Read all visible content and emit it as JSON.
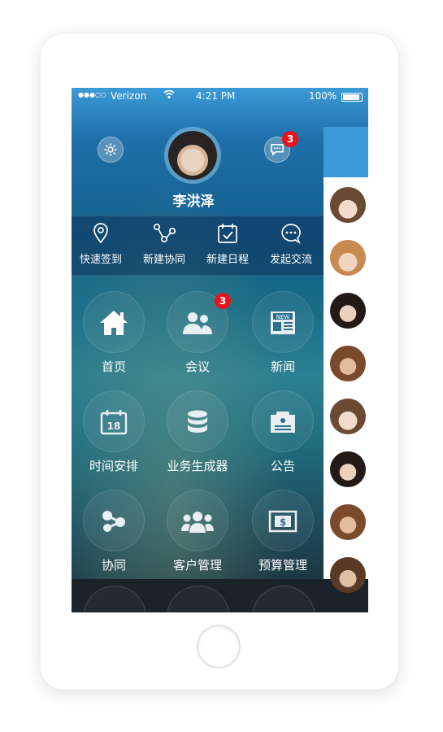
{
  "status_bar": {
    "signal": "●●●○○",
    "carrier": "Verizon",
    "time": "4:21 PM",
    "battery": "100%"
  },
  "header": {
    "user_name": "李洪泽",
    "message_badge": "3",
    "icons": {
      "left": "gear-icon",
      "right": "message-icon"
    }
  },
  "quick_actions": [
    {
      "label": "快速签到",
      "icon": "location-pin-icon"
    },
    {
      "label": "新建协同",
      "icon": "share-nodes-icon"
    },
    {
      "label": "新建日程",
      "icon": "calendar-check-icon"
    },
    {
      "label": "发起交流",
      "icon": "chat-bubble-icon"
    }
  ],
  "menu": [
    {
      "label": "首页",
      "icon": "home-icon"
    },
    {
      "label": "会议",
      "icon": "people-icon",
      "badge": "3"
    },
    {
      "label": "新闻",
      "icon": "newspaper-icon",
      "icon_text": "NEW"
    },
    {
      "label": "时间安排",
      "icon": "calendar-icon",
      "icon_text": "18"
    },
    {
      "label": "业务生成器",
      "icon": "database-icon"
    },
    {
      "label": "公告",
      "icon": "announcement-icon"
    },
    {
      "label": "协同",
      "icon": "collaborate-icon"
    },
    {
      "label": "客户管理",
      "icon": "customers-icon"
    },
    {
      "label": "预算管理",
      "icon": "money-icon",
      "icon_text": "$"
    }
  ],
  "colors": {
    "accent_blue": "#3d9ad8",
    "badge_red": "#e8141c"
  }
}
